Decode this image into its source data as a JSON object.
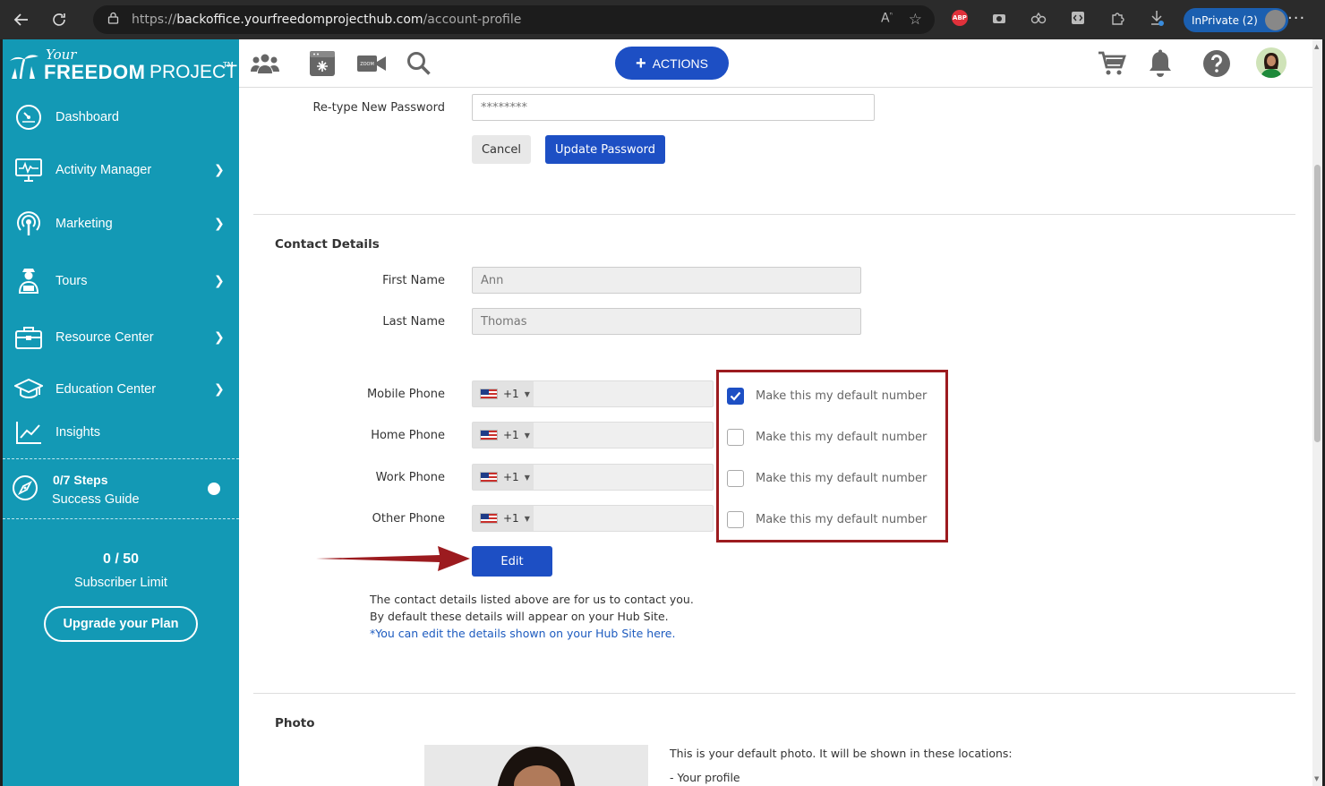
{
  "browser": {
    "url_prefix": "https://",
    "url_host": "backoffice.yourfreedomprojecthub.com",
    "url_path": "/account-profile",
    "abp_label": "ABP",
    "inprivate_label": "InPrivate (2)"
  },
  "logo": {
    "your": "Your",
    "freedom": "FREEDOM",
    "project": "PROJECT",
    "tm": "TM"
  },
  "sidebar": {
    "items": [
      {
        "label": "Dashboard",
        "icon": "speedometer-icon",
        "has_chevron": false
      },
      {
        "label": "Activity Manager",
        "icon": "monitor-pulse-icon",
        "has_chevron": true
      },
      {
        "label": "Marketing",
        "icon": "broadcast-icon",
        "has_chevron": true
      },
      {
        "label": "Tours",
        "icon": "tour-guide-icon",
        "has_chevron": true
      },
      {
        "label": "Resource Center",
        "icon": "briefcase-icon",
        "has_chevron": true
      },
      {
        "label": "Education Center",
        "icon": "graduation-cap-icon",
        "has_chevron": true
      },
      {
        "label": "Insights",
        "icon": "trend-chart-icon",
        "has_chevron": false
      }
    ],
    "guide_steps": "0/7 Steps",
    "guide_label": "Success Guide",
    "subscriber_count": "0 / 50",
    "subscriber_label": "Subscriber Limit",
    "upgrade_label": "Upgrade your Plan"
  },
  "topbar": {
    "zoom_label": "ZOOM",
    "actions_label": "ACTIONS"
  },
  "password": {
    "retype_label": "Re-type New Password",
    "retype_value": "********",
    "cancel_label": "Cancel",
    "update_label": "Update Password"
  },
  "contact": {
    "title": "Contact Details",
    "first_name_label": "First Name",
    "first_name_value": "Ann",
    "last_name_label": "Last Name",
    "last_name_value": "Thomas",
    "phones": [
      {
        "label": "Mobile Phone",
        "code": "+1",
        "default_checked": true,
        "default_label": "Make this my default number"
      },
      {
        "label": "Home Phone",
        "code": "+1",
        "default_checked": false,
        "default_label": "Make this my default number"
      },
      {
        "label": "Work Phone",
        "code": "+1",
        "default_checked": false,
        "default_label": "Make this my default number"
      },
      {
        "label": "Other Phone",
        "code": "+1",
        "default_checked": false,
        "default_label": "Make this my default number"
      }
    ],
    "edit_label": "Edit",
    "note_line1": "The contact details listed above are for us to contact you.",
    "note_line2": "By default these details will appear on your Hub Site.",
    "note_link": "*You can edit the details shown on your Hub Site here."
  },
  "photo": {
    "title": "Photo",
    "note_line1": "This is your default photo. It will be shown in these locations:",
    "note_line2": "- Your profile"
  },
  "colors": {
    "sidebar_bg": "#1399b5",
    "primary": "#1d4fc4",
    "highlight": "#9c1b1f"
  }
}
